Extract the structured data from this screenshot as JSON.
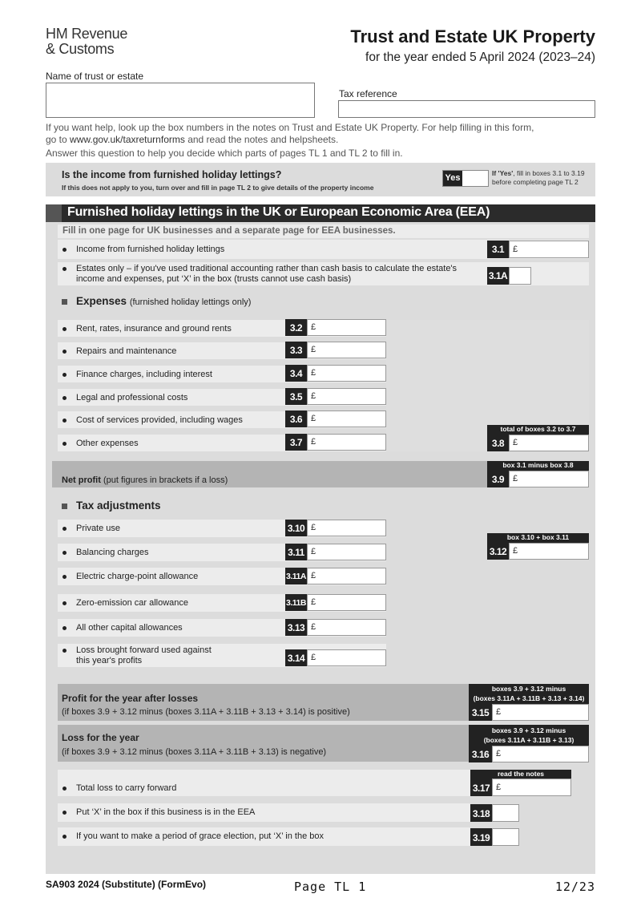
{
  "header": {
    "logo_line1": "HM Revenue",
    "logo_line2": "& Customs",
    "title": "Trust and Estate UK Property",
    "subtitle": "for the year ended 5 April 2024 (2023–24)"
  },
  "identity": {
    "name_label": "Name of trust or estate",
    "name_value": "",
    "taxref_label": "Tax reference",
    "taxref_value": ""
  },
  "help": {
    "line1": "If you want help, look up the box numbers in the notes on Trust and Estate UK Property. For help filling in this form,",
    "line2_pre": "go to ",
    "line2_link": "www.gov.uk/taxreturnforms",
    "line2_post": " and read the notes and helpsheets.",
    "line3": "Answer this question to help you decide which parts of pages TL 1 and TL 2 to fill in."
  },
  "question": {
    "title": "Is the income from furnished holiday lettings?",
    "subtitle": "If this does not apply to you, turn over and fill in page TL 2 to give details of the property income",
    "yes_label": "Yes",
    "yes_value": "",
    "note_bold": "If 'Yes'",
    "note_rest": ", fill in boxes 3.1 to 3.19 before completing page TL 2"
  },
  "section": {
    "title": "Furnished holiday lettings in the UK or European Economic Area (EEA)",
    "fill_note": "Fill in one page for UK businesses and a separate page for EEA businesses.",
    "currency": "£",
    "income": [
      {
        "box": "3.1",
        "label": "Income from furnished holiday lettings",
        "value": ""
      },
      {
        "box": "3.1A",
        "label_line1": "Estates only – if you've used traditional accounting rather than cash basis to calculate the estate's",
        "label_line2": "income and expenses, put ‘X’ in the box (trusts cannot use cash basis)",
        "value": ""
      }
    ],
    "expenses_heading": "Expenses",
    "expenses_note": "(furnished holiday lettings only)",
    "expenses": [
      {
        "box": "3.2",
        "label": "Rent, rates, insurance and ground rents",
        "value": ""
      },
      {
        "box": "3.3",
        "label": "Repairs and maintenance",
        "value": ""
      },
      {
        "box": "3.4",
        "label": "Finance charges, including interest",
        "value": ""
      },
      {
        "box": "3.5",
        "label": "Legal and professional costs",
        "value": ""
      },
      {
        "box": "3.6",
        "label": "Cost of services provided, including wages",
        "value": ""
      },
      {
        "box": "3.7",
        "label": "Other expenses",
        "value": ""
      }
    ],
    "total_expenses": {
      "box": "3.8",
      "caption": "total of boxes 3.2 to 3.7",
      "value": ""
    },
    "net_profit": {
      "label_bold": "Net profit",
      "label_rest": " (put figures in brackets if a loss)",
      "box": "3.9",
      "caption": "box 3.1 minus box 3.8",
      "value": ""
    },
    "tax_adj_heading": "Tax adjustments",
    "tax_adjustments": [
      {
        "box": "3.10",
        "label": "Private use",
        "value": ""
      },
      {
        "box": "3.11",
        "label": "Balancing charges",
        "value": ""
      },
      {
        "box": "3.11A",
        "label": "Electric charge-point allowance",
        "value": ""
      },
      {
        "box": "3.11B",
        "label": "Zero-emission car allowance",
        "value": ""
      },
      {
        "box": "3.13",
        "label": "All other capital allowances",
        "value": ""
      },
      {
        "box": "3.14",
        "label_line1": "Loss brought forward used against",
        "label_line2": "this year's profits",
        "value": ""
      }
    ],
    "box_312": {
      "box": "3.12",
      "caption": "box 3.10 + box 3.11",
      "value": ""
    },
    "profit": {
      "title": "Profit for the year after losses",
      "note": "(if boxes 3.9 + 3.12 minus (boxes 3.11A + 3.11B + 3.13 + 3.14) is positive)",
      "box": "3.15",
      "caption_line1": "boxes 3.9 + 3.12 minus",
      "caption_line2": "(boxes 3.11A + 3.11B + 3.13 + 3.14)",
      "value": ""
    },
    "loss": {
      "title": "Loss for the year",
      "note": "(if boxes 3.9 + 3.12 minus (boxes 3.11A + 3.11B + 3.13) is negative)",
      "box": "3.16",
      "caption_line1": "boxes 3.9 + 3.12 minus",
      "caption_line2": "(boxes 3.11A + 3.11B + 3.13)",
      "value": ""
    },
    "final": [
      {
        "box": "3.17",
        "label": "Total loss to carry forward",
        "caption": "read the notes",
        "value": ""
      },
      {
        "box": "3.18",
        "label": "Put ‘X’ in the box if this business is in the EEA",
        "value": ""
      },
      {
        "box": "3.19",
        "label": "If you want to make a period of grace election, put ‘X’ in the box",
        "value": ""
      }
    ]
  },
  "footer": {
    "form_id": "SA903 2024 (Substitute) (FormEvo)",
    "page_label": "Page TL 1",
    "page_count": "12/23"
  }
}
